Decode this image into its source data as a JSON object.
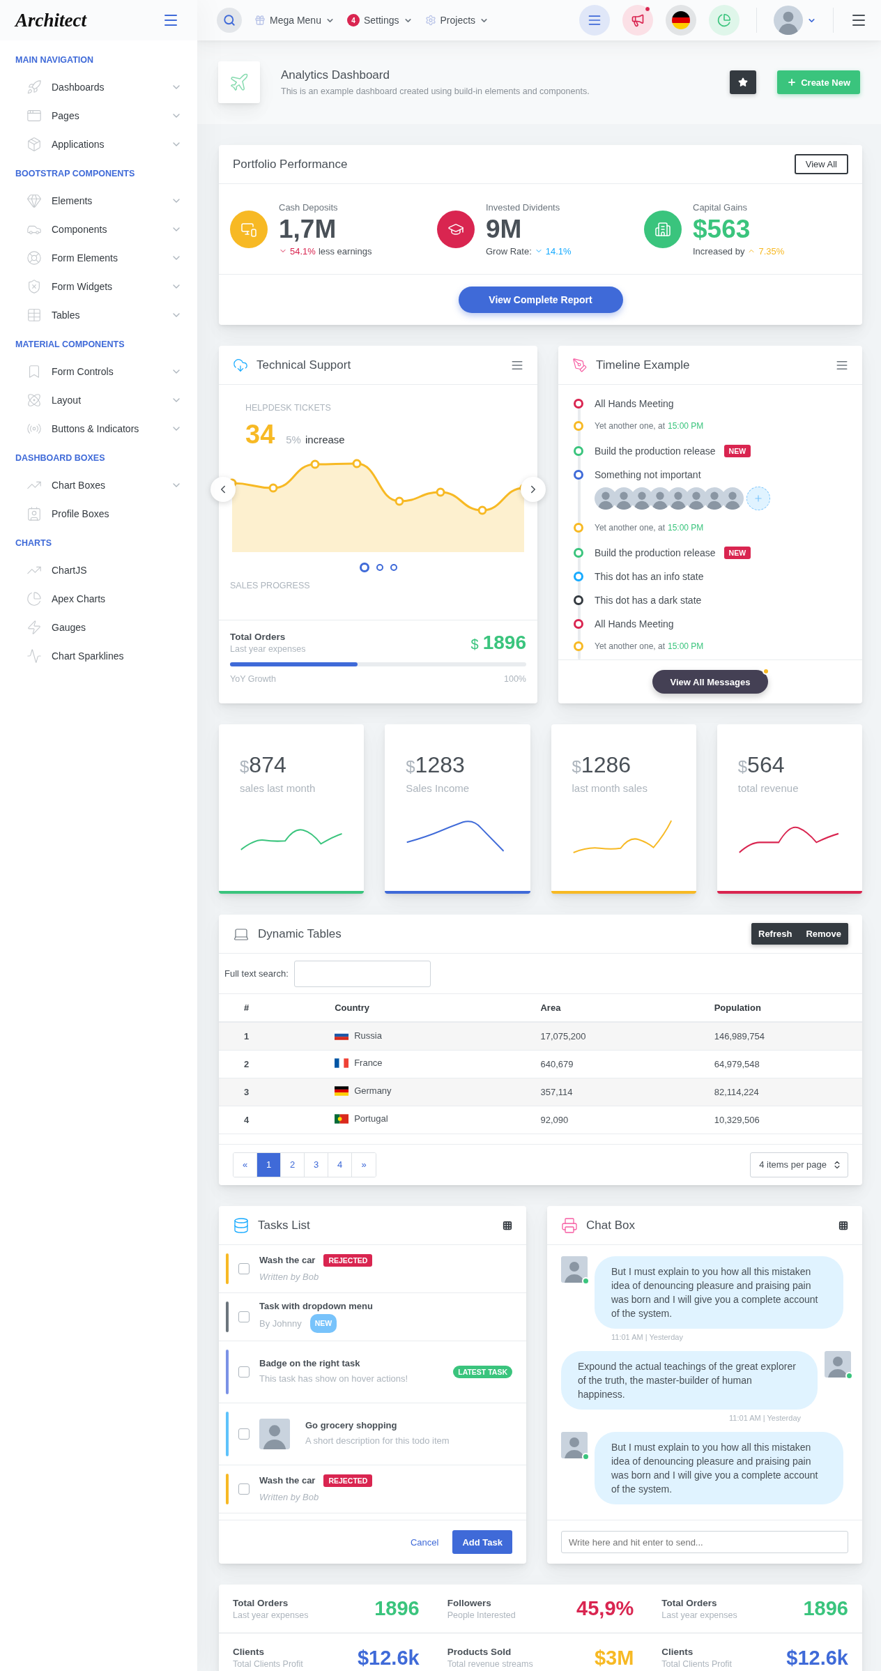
{
  "sidebar": {
    "logo": "Architect",
    "sections": [
      {
        "title": "MAIN NAVIGATION",
        "items": [
          {
            "label": "Dashboards",
            "expandable": true
          },
          {
            "label": "Pages",
            "expandable": true
          },
          {
            "label": "Applications",
            "expandable": true
          }
        ]
      },
      {
        "title": "BOOTSTRAP COMPONENTS",
        "items": [
          {
            "label": "Elements",
            "expandable": true
          },
          {
            "label": "Components",
            "expandable": true
          },
          {
            "label": "Form Elements",
            "expandable": true
          },
          {
            "label": "Form Widgets",
            "expandable": true
          },
          {
            "label": "Tables",
            "expandable": true
          }
        ]
      },
      {
        "title": "MATERIAL COMPONENTS",
        "items": [
          {
            "label": "Form Controls",
            "expandable": true
          },
          {
            "label": "Layout",
            "expandable": true
          },
          {
            "label": "Buttons & Indicators",
            "expandable": true
          }
        ]
      },
      {
        "title": "DASHBOARD BOXES",
        "items": [
          {
            "label": "Chart Boxes",
            "expandable": true
          },
          {
            "label": "Profile Boxes",
            "expandable": false
          }
        ]
      },
      {
        "title": "CHARTS",
        "items": [
          {
            "label": "ChartJS",
            "expandable": false
          },
          {
            "label": "Apex Charts",
            "expandable": false
          },
          {
            "label": "Gauges",
            "expandable": false
          },
          {
            "label": "Chart Sparklines",
            "expandable": false
          }
        ]
      }
    ]
  },
  "topbar": {
    "menus": [
      {
        "label": "Mega Menu"
      },
      {
        "label": "Settings",
        "badge": "4"
      },
      {
        "label": "Projects"
      }
    ],
    "icon_buttons": [
      {
        "notification": false
      },
      {
        "notification": true
      },
      {
        "notification": false
      },
      {
        "notification": false
      }
    ]
  },
  "page_header": {
    "title": "Analytics Dashboard",
    "subtitle": "This is an example dashboard created using build-in elements and components.",
    "create_button": "Create New"
  },
  "portfolio": {
    "title": "Portfolio Performance",
    "view_all": "View All",
    "metrics": [
      {
        "label": "Cash Deposits",
        "icon": {
          "color": "#f7b924"
        },
        "value": {
          "text": "1,7M",
          "color": "#495057"
        },
        "change": {
          "kind": "down",
          "amount": "54.1%",
          "color": "#d92550",
          "suffix": "less earnings"
        }
      },
      {
        "label": "Invested Dividents",
        "icon": {
          "color": "#d92550"
        },
        "value": {
          "text": "9M",
          "color": "#495057"
        },
        "change": {
          "prefix": "Grow Rate:",
          "kind": "down",
          "amount": "14.1%",
          "color": "#16aaff"
        }
      },
      {
        "label": "Capital Gains",
        "icon": {
          "color": "#3ac47d"
        },
        "value": {
          "text": "$563",
          "color": "#3ac47d"
        },
        "change": {
          "prefix": "Increased by",
          "kind": "up",
          "amount": "7.35%",
          "color": "#f7b924"
        }
      }
    ],
    "report_button": "View Complete Report"
  },
  "support": {
    "title": "Technical Support",
    "tickets_label": "HELPDESK TICKETS",
    "tickets_value": "34",
    "tickets_change": "5%",
    "tickets_change_label": "increase",
    "slides": [
      {
        "selected": true
      },
      {
        "selected": false
      },
      {
        "selected": false
      }
    ],
    "sales_label": "SALES PROGRESS",
    "orders_title": "Total Orders",
    "orders_subtitle": "Last year expenses",
    "currency": "$",
    "orders_value": "1896",
    "progress": {
      "level": 0.43,
      "label": "YoY Growth",
      "reading": "100%"
    }
  },
  "timeline": {
    "title": "Timeline Example",
    "items": [
      {
        "kind": "event",
        "text": "All Hands Meeting",
        "color": "#d92550"
      },
      {
        "kind": "note",
        "text": "Yet another one, at",
        "time": "15:00 PM",
        "color": "#f7b924"
      },
      {
        "kind": "event",
        "text": "Build the production release",
        "badge": "NEW",
        "color": "#3ac47d"
      },
      {
        "kind": "event",
        "text": "Something not important",
        "color": "#3f6ad8",
        "avatars": true
      },
      {
        "kind": "note",
        "text": "Yet another one, at",
        "time": "15:00 PM",
        "color": "#f7b924"
      },
      {
        "kind": "event",
        "text": "Build the production release",
        "badge": "NEW",
        "color": "#3ac47d"
      },
      {
        "kind": "event",
        "text": "This dot has an info state",
        "color": "#16aaff"
      },
      {
        "kind": "event",
        "text": "This dot has a dark state",
        "color": "#343a40"
      },
      {
        "kind": "event",
        "text": "All Hands Meeting",
        "color": "#d92550"
      },
      {
        "kind": "note",
        "text": "Yet another one, at",
        "time": "15:00 PM",
        "color": "#f7b924"
      }
    ],
    "button": "View All Messages"
  },
  "stat_cards": [
    {
      "currency": "$",
      "value": "874",
      "label": "sales last month",
      "color": "#3ac47d"
    },
    {
      "currency": "$",
      "value": "1283",
      "label": "Sales Income",
      "color": "#3f6ad8"
    },
    {
      "currency": "$",
      "value": "1286",
      "label": "last month sales",
      "color": "#f7b924"
    },
    {
      "currency": "$",
      "value": "564",
      "label": "total revenue",
      "color": "#d92550"
    }
  ],
  "table": {
    "title": "Dynamic Tables",
    "buttons": [
      "Refresh",
      "Remove"
    ],
    "search_label": "Full text search:",
    "columns": [
      "#",
      "Country",
      "Area",
      "Population"
    ],
    "rows": [
      {
        "index": "1",
        "country": "Russia",
        "area": "17,075,200",
        "population": "146,989,754"
      },
      {
        "index": "2",
        "country": "France",
        "area": "640,679",
        "population": "64,979,548"
      },
      {
        "index": "3",
        "country": "Germany",
        "area": "357,114",
        "population": "82,114,224"
      },
      {
        "index": "4",
        "country": "Portugal",
        "area": "92,090",
        "population": "10,329,506"
      }
    ],
    "pagination": [
      {
        "label": "«",
        "selected": false
      },
      {
        "label": "1",
        "selected": true
      },
      {
        "label": "2",
        "selected": false
      },
      {
        "label": "3",
        "selected": false
      },
      {
        "label": "4",
        "selected": false
      },
      {
        "label": "»",
        "selected": false
      }
    ],
    "page_size": "4 items per page"
  },
  "tasks": {
    "title": "Tasks List",
    "items": [
      {
        "kind": "basic",
        "title": "Wash the car",
        "subtitle": "Written by Bob",
        "badge": {
          "text": "REJECTED",
          "color": "#d92550"
        },
        "color": "#f7b924",
        "checked": false
      },
      {
        "kind": "tag",
        "title": "Task with dropdown menu",
        "subtitle": "By Johnny",
        "badge": {
          "text": "NEW",
          "color": "#78c3fb"
        },
        "color": "#6c757d",
        "checked": false
      },
      {
        "kind": "right",
        "title": "Badge on the right task",
        "subtitle": "This task has show on hover actions!",
        "badge": {
          "text": "LATEST TASK",
          "color": "#3ac47d"
        },
        "color": "#7b92e6",
        "checked": false
      },
      {
        "kind": "avatar",
        "title": "Go grocery shopping",
        "subtitle": "A short description for this todo item",
        "color": "#5ec3fb",
        "checked": false
      },
      {
        "kind": "basic",
        "title": "Wash the car",
        "subtitle": "Written by Bob",
        "badge": {
          "text": "REJECTED",
          "color": "#d92550"
        },
        "color": "#f7b924",
        "checked": false
      }
    ],
    "cancel": "Cancel",
    "add": "Add Task"
  },
  "chat": {
    "title": "Chat Box",
    "messages": [
      {
        "kind": "incoming",
        "text": "But I must explain to you how all this mistaken idea of denouncing pleasure and praising pain was born and I will give you a complete account of the system.",
        "time": "11:01 AM | Yesterday"
      },
      {
        "kind": "outgoing",
        "text": "Expound the actual teachings of the great explorer of the truth, the master-builder of human happiness.",
        "time": "11:01 AM | Yesterday"
      },
      {
        "kind": "incoming",
        "text": "But I must explain to you how all this mistaken idea of denouncing pleasure and praising pain was born and I will give you a complete account of the system."
      }
    ],
    "placeholder": "Write here and hit enter to send..."
  },
  "summary": [
    {
      "title": "Total Orders",
      "subtitle": "Last year expenses",
      "value": "1896",
      "color": "#3ac47d"
    },
    {
      "title": "Followers",
      "subtitle": "People Interested",
      "value": "45,9%",
      "color": "#d92550"
    },
    {
      "title": "Total Orders",
      "subtitle": "Last year expenses",
      "value": "1896",
      "color": "#3ac47d"
    },
    {
      "title": "Clients",
      "subtitle": "Total Clients Profit",
      "value": "$12.6k",
      "color": "#3f6ad8"
    },
    {
      "title": "Products Sold",
      "subtitle": "Total revenue streams",
      "value": "$3M",
      "color": "#f7b924"
    },
    {
      "title": "Clients",
      "subtitle": "Total Clients Profit",
      "value": "$12.6k",
      "color": "#3f6ad8"
    }
  ]
}
